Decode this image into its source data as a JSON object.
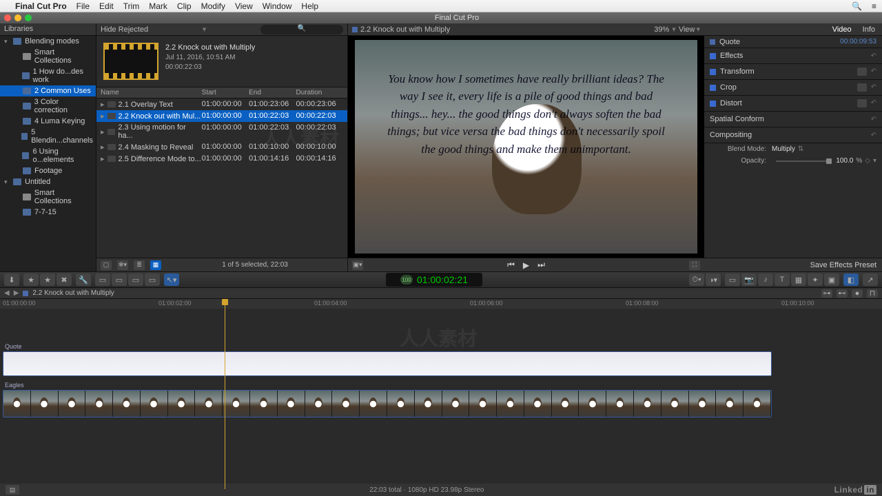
{
  "menubar": {
    "app": "Final Cut Pro",
    "items": [
      "File",
      "Edit",
      "Trim",
      "Mark",
      "Clip",
      "Modify",
      "View",
      "Window",
      "Help"
    ]
  },
  "window_title": "Final Cut Pro",
  "library": {
    "header": "Libraries",
    "tree": [
      {
        "label": "Blending modes",
        "indent": 0,
        "open": true,
        "icon": "lib"
      },
      {
        "label": "Smart Collections",
        "indent": 1,
        "icon": "star"
      },
      {
        "label": "1 How do...des work",
        "indent": 1,
        "icon": "event"
      },
      {
        "label": "2 Common Uses",
        "indent": 1,
        "icon": "event",
        "selected": true
      },
      {
        "label": "3 Color correction",
        "indent": 1,
        "icon": "event"
      },
      {
        "label": "4 Luma Keying",
        "indent": 1,
        "icon": "event"
      },
      {
        "label": "5 Blendin...channels",
        "indent": 1,
        "icon": "event"
      },
      {
        "label": "6 Using o...elements",
        "indent": 1,
        "icon": "event"
      },
      {
        "label": "Footage",
        "indent": 1,
        "icon": "event"
      },
      {
        "label": "Untitled",
        "indent": 0,
        "open": true,
        "icon": "lib"
      },
      {
        "label": "Smart Collections",
        "indent": 1,
        "icon": "star"
      },
      {
        "label": "7-7-15",
        "indent": 1,
        "icon": "event"
      }
    ]
  },
  "browser": {
    "hide_rejected": "Hide Rejected",
    "search_placeholder": "🔍",
    "selected_clip": {
      "title": "2.2 Knock out with Multiply",
      "date": "Jul 11, 2016, 10:51 AM",
      "duration": "00:00:22:03"
    },
    "columns": [
      "Name",
      "Start",
      "End",
      "Duration"
    ],
    "rows": [
      {
        "name": "2.1 Overlay Text",
        "start": "01:00:00:00",
        "end": "01:00:23:06",
        "dur": "00:00:23:06"
      },
      {
        "name": "2.2 Knock out with Mul...",
        "start": "01:00:00:00",
        "end": "01:00:22:03",
        "dur": "00:00:22:03",
        "selected": true
      },
      {
        "name": "2.3 Using motion for ha...",
        "start": "01:00:00:00",
        "end": "01:00:22:03",
        "dur": "00:00:22:03"
      },
      {
        "name": "2.4 Masking to Reveal",
        "start": "01:00:00:00",
        "end": "01:00:10:00",
        "dur": "00:00:10:00"
      },
      {
        "name": "2.5 Difference Mode to...",
        "start": "01:00:00:00",
        "end": "01:00:14:16",
        "dur": "00:00:14:16"
      }
    ],
    "footer": "1 of 5 selected, 22:03"
  },
  "viewer": {
    "title": "2.2 Knock out with Multiply",
    "zoom": "39%",
    "view_label": "View",
    "quote_text": "You know how I sometimes have really brilliant ideas? The way I see it, every life is a pile of good things and bad things... hey... the good things don't always soften the bad things; but vice versa the bad things don't necessarily spoil the good things and make them unimportant."
  },
  "inspector": {
    "tabs": {
      "video": "Video",
      "info": "Info"
    },
    "clip_name": "Quote",
    "clip_tc": "00:00:09:53",
    "sections": {
      "effects": "Effects",
      "transform": "Transform",
      "crop": "Crop",
      "distort": "Distort",
      "spatial": "Spatial Conform",
      "compositing": "Compositing"
    },
    "blend_mode_label": "Blend Mode:",
    "blend_mode_value": "Multiply",
    "opacity_label": "Opacity:",
    "opacity_value": "100.0",
    "opacity_suffix": "%",
    "save_preset": "Save Effects Preset"
  },
  "timecode": "01:00:02:21",
  "tc_badge": "100",
  "timeline": {
    "title": "2.2 Knock out with Multiply",
    "ruler": [
      {
        "label": "01:00:00:00",
        "pos": 4
      },
      {
        "label": "01:00:02:00",
        "pos": 230
      },
      {
        "label": "01:00:04:00",
        "pos": 456
      },
      {
        "label": "01:00:06:00",
        "pos": 682
      },
      {
        "label": "01:00:08:00",
        "pos": 908
      },
      {
        "label": "01:00:10:00",
        "pos": 1134
      }
    ],
    "tracks": {
      "quote": "Quote",
      "eagles": "Eagles"
    }
  },
  "status": "22:03 total · 1080p HD 23.98p Stereo",
  "brand": {
    "text": "Linked",
    "suffix": "in"
  }
}
